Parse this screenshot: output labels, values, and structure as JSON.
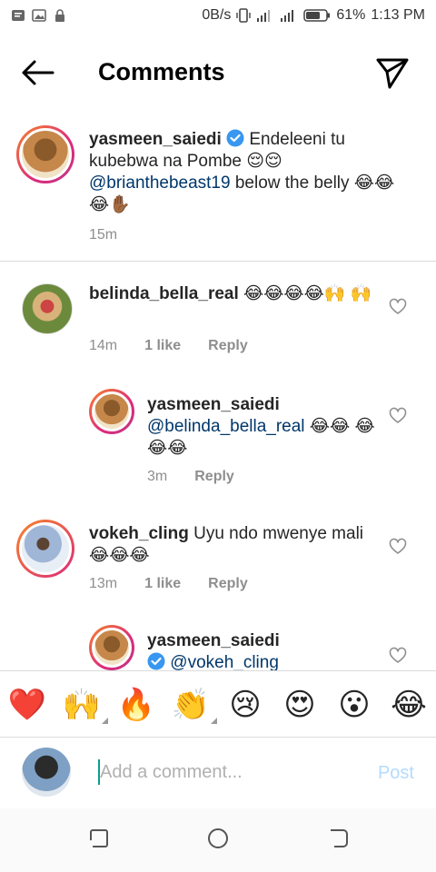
{
  "status_bar": {
    "data_speed": "0B/s",
    "battery": "61%",
    "time": "1:13 PM"
  },
  "header": {
    "title": "Comments"
  },
  "comments": [
    {
      "username": "yasmeen_saiedi",
      "verified": true,
      "text": "Endeleeni tu kubebwa na Pombe 😌😌",
      "mention": "@brianthebeast19",
      "text_after": " below the belly 😂😂😂✋🏾",
      "time": "15m"
    },
    {
      "username": "belinda_bella_real",
      "text": "😂😂😂😂🙌 🙌",
      "time": "14m",
      "likes": "1 like",
      "reply_label": "Reply"
    },
    {
      "username": "yasmeen_saiedi",
      "mention": "@belinda_bella_real",
      "text": " 😂😂 😂😂😂",
      "time": "3m",
      "reply_label": "Reply"
    },
    {
      "username": "vokeh_cling",
      "text": "Uyu ndo mwenye mali😂😂😂",
      "time": "13m",
      "likes": "1 like",
      "reply_label": "Reply"
    },
    {
      "username": "yasmeen_saiedi",
      "verified": true,
      "mention": "@vokeh_cling"
    }
  ],
  "emoji_bar": [
    "❤️",
    "🙌",
    "🔥",
    "👏",
    "😢",
    "😍",
    "😮",
    "😂"
  ],
  "composer": {
    "placeholder": "Add a comment...",
    "post_label": "Post"
  },
  "colors": {
    "mention": "#00376b",
    "post_disabled": "#b3dbff",
    "verified_blue": "#3897f0"
  }
}
